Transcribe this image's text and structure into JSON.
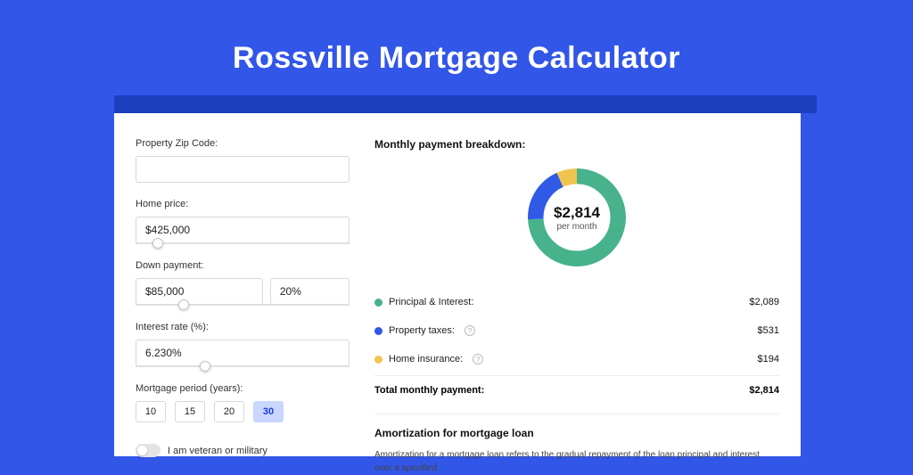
{
  "page": {
    "title": "Rossville Mortgage Calculator"
  },
  "colors": {
    "principal": "#47b28b",
    "taxes": "#2f59e6",
    "insurance": "#f1c452"
  },
  "form": {
    "zip": {
      "label": "Property Zip Code:",
      "value": ""
    },
    "home_price": {
      "label": "Home price:",
      "value": "$425,000",
      "slider_pct": 8
    },
    "down_payment": {
      "label": "Down payment:",
      "amount": "$85,000",
      "pct": "20%",
      "slider_pct": 20
    },
    "interest_rate": {
      "label": "Interest rate (%):",
      "value": "6.230%",
      "slider_pct": 30
    },
    "mortgage_period": {
      "label": "Mortgage period (years):",
      "options": [
        "10",
        "15",
        "20",
        "30"
      ],
      "selected": "30"
    },
    "veteran": {
      "label": "I am veteran or military",
      "on": false
    }
  },
  "breakdown": {
    "title": "Monthly payment breakdown:",
    "center_amount": "$2,814",
    "center_sub": "per month",
    "items": [
      {
        "label": "Principal & Interest:",
        "value": "$2,089",
        "color": "#47b28b",
        "info": false
      },
      {
        "label": "Property taxes:",
        "value": "$531",
        "color": "#2f59e6",
        "info": true
      },
      {
        "label": "Home insurance:",
        "value": "$194",
        "color": "#f1c452",
        "info": true
      }
    ],
    "total_label": "Total monthly payment:",
    "total_value": "$2,814"
  },
  "chart_data": {
    "type": "pie",
    "title": "Monthly payment breakdown",
    "series": [
      {
        "name": "Principal & Interest",
        "value": 2089
      },
      {
        "name": "Property taxes",
        "value": 531
      },
      {
        "name": "Home insurance",
        "value": 194
      }
    ],
    "total": 2814
  },
  "amortization": {
    "title": "Amortization for mortgage loan",
    "text": "Amortization for a mortgage loan refers to the gradual repayment of the loan principal and interest over a specified"
  }
}
